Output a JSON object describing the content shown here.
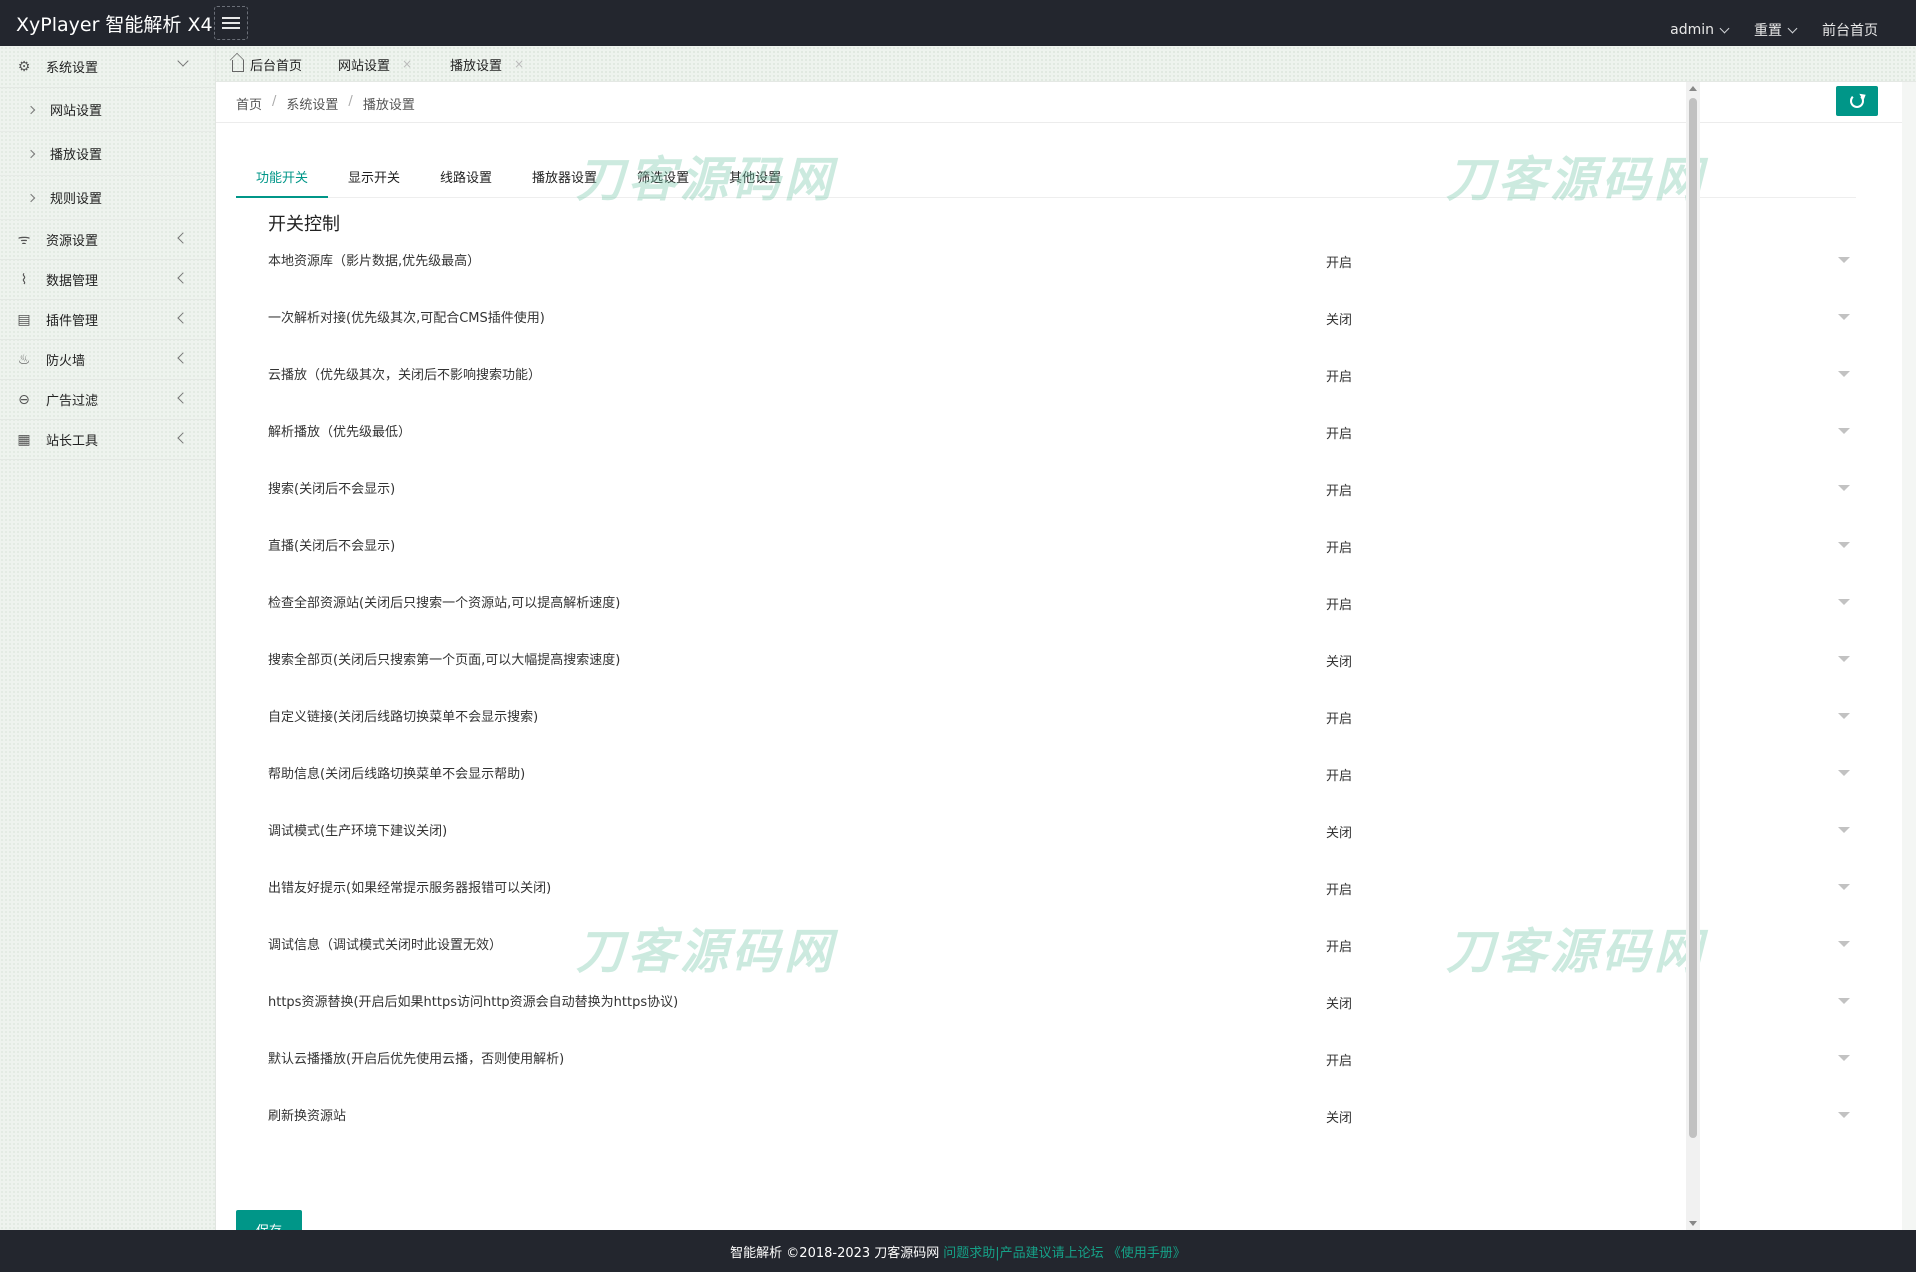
{
  "header": {
    "brand": "XyPlayer 智能解析 X4",
    "menu_icon": "hamburger-icon",
    "right_items": [
      {
        "label": "admin"
      },
      {
        "label": "重置"
      },
      {
        "label": "前台首页"
      }
    ]
  },
  "sidebar": {
    "groups": [
      {
        "label": "系统设置",
        "icon": "gear-icon",
        "open": true,
        "children": [
          {
            "label": "网站设置"
          },
          {
            "label": "播放设置"
          },
          {
            "label": "规则设置"
          }
        ]
      },
      {
        "label": "资源设置",
        "icon": "rss-icon"
      },
      {
        "label": "数据管理",
        "icon": "pulse-icon"
      },
      {
        "label": "插件管理",
        "icon": "plugin-icon"
      },
      {
        "label": "防火墙",
        "icon": "fire-icon"
      },
      {
        "label": "广告过滤",
        "icon": "minus-circle-icon"
      },
      {
        "label": "站长工具",
        "icon": "grid-icon"
      }
    ]
  },
  "tabs": [
    {
      "label": "后台首页"
    },
    {
      "label": "网站设置"
    },
    {
      "label": "播放设置"
    }
  ],
  "breadcrumb": [
    "首页",
    "系统设置",
    "播放设置"
  ],
  "panel_tabs": [
    "功能开关",
    "显示开关",
    "线路设置",
    "播放器设置",
    "筛选设置",
    "其他设置"
  ],
  "section_title": "开关控制",
  "settings": [
    {
      "label": "本地资源库（影片数据,优先级最高）",
      "value": "开启"
    },
    {
      "label": "一次解析对接(优先级其次,可配合CMS插件使用)",
      "value": "关闭"
    },
    {
      "label": "云播放（优先级其次，关闭后不影响搜索功能）",
      "value": "开启"
    },
    {
      "label": "解析播放（优先级最低）",
      "value": "开启"
    },
    {
      "label": "搜索(关闭后不会显示)",
      "value": "开启"
    },
    {
      "label": "直播(关闭后不会显示)",
      "value": "开启"
    },
    {
      "label": "检查全部资源站(关闭后只搜索一个资源站,可以提高解析速度)",
      "value": "开启"
    },
    {
      "label": "搜索全部页(关闭后只搜索第一个页面,可以大幅提高搜索速度)",
      "value": "关闭"
    },
    {
      "label": "自定义链接(关闭后线路切换菜单不会显示搜索)",
      "value": "开启"
    },
    {
      "label": "帮助信息(关闭后线路切换菜单不会显示帮助)",
      "value": "开启"
    },
    {
      "label": "调试模式(生产环境下建议关闭)",
      "value": "关闭"
    },
    {
      "label": "出错友好提示(如果经常提示服务器报错可以关闭)",
      "value": "开启"
    },
    {
      "label": "调试信息（调试模式关闭时此设置无效）",
      "value": "开启"
    },
    {
      "label": "https资源替换(开启后如果https访问http资源会自动替换为https协议)",
      "value": "关闭"
    },
    {
      "label": "默认云播播放(开启后优先使用云播，否则使用解析)",
      "value": "开启"
    },
    {
      "label": "刷新换资源站",
      "value": "关闭"
    }
  ],
  "save_label": "保存",
  "watermark_text": "刀客源码网",
  "footer": {
    "copyright": "智能解析 ©2018-2023 刀客源码网",
    "link": "问题求助|产品建议请上论坛 《使用手册》"
  },
  "colors": {
    "accent": "#009688",
    "header_bg": "#23262e"
  }
}
